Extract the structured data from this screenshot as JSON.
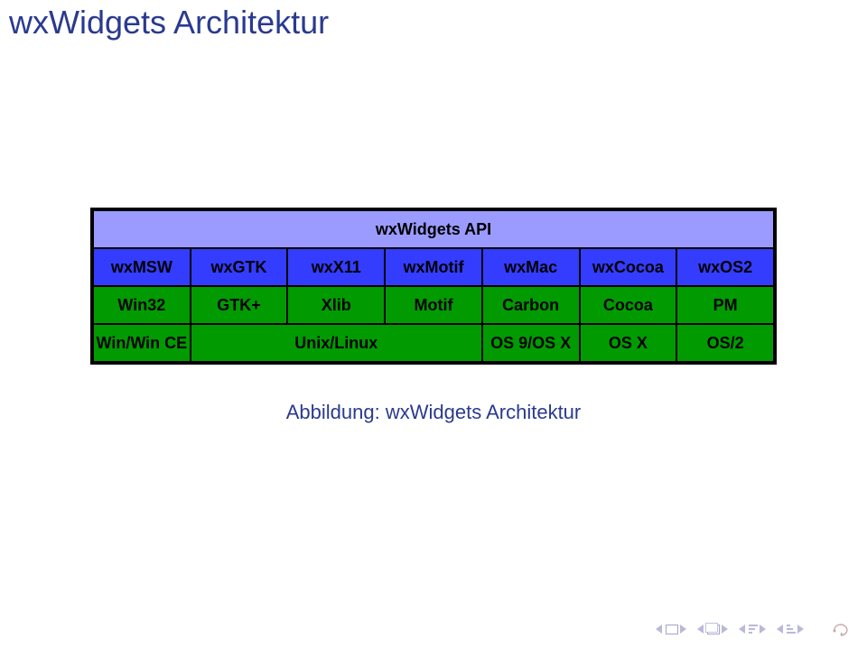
{
  "title": "wxWidgets Architektur",
  "table": {
    "api": "wxWidgets API",
    "wx": [
      "wxMSW",
      "wxGTK",
      "wxX11",
      "wxMotif",
      "wxMac",
      "wxCocoa",
      "wxOS2"
    ],
    "lib": [
      "Win32",
      "GTK+",
      "Xlib",
      "Motif",
      "Carbon",
      "Cocoa",
      "PM"
    ],
    "os": {
      "winwince": "Win/Win CE",
      "unixlinux": "Unix/Linux",
      "os9osx": "OS 9/OS X",
      "osx": "OS X",
      "os2": "OS/2"
    }
  },
  "caption_prefix": "Abbildung:",
  "caption_text": "wxWidgets Architektur",
  "nav_icons": [
    "prev-slide",
    "slide",
    "prev-section",
    "section-stack",
    "prev-sub-a",
    "bars-a",
    "prev-sub-b",
    "bars-b",
    "undo"
  ]
}
